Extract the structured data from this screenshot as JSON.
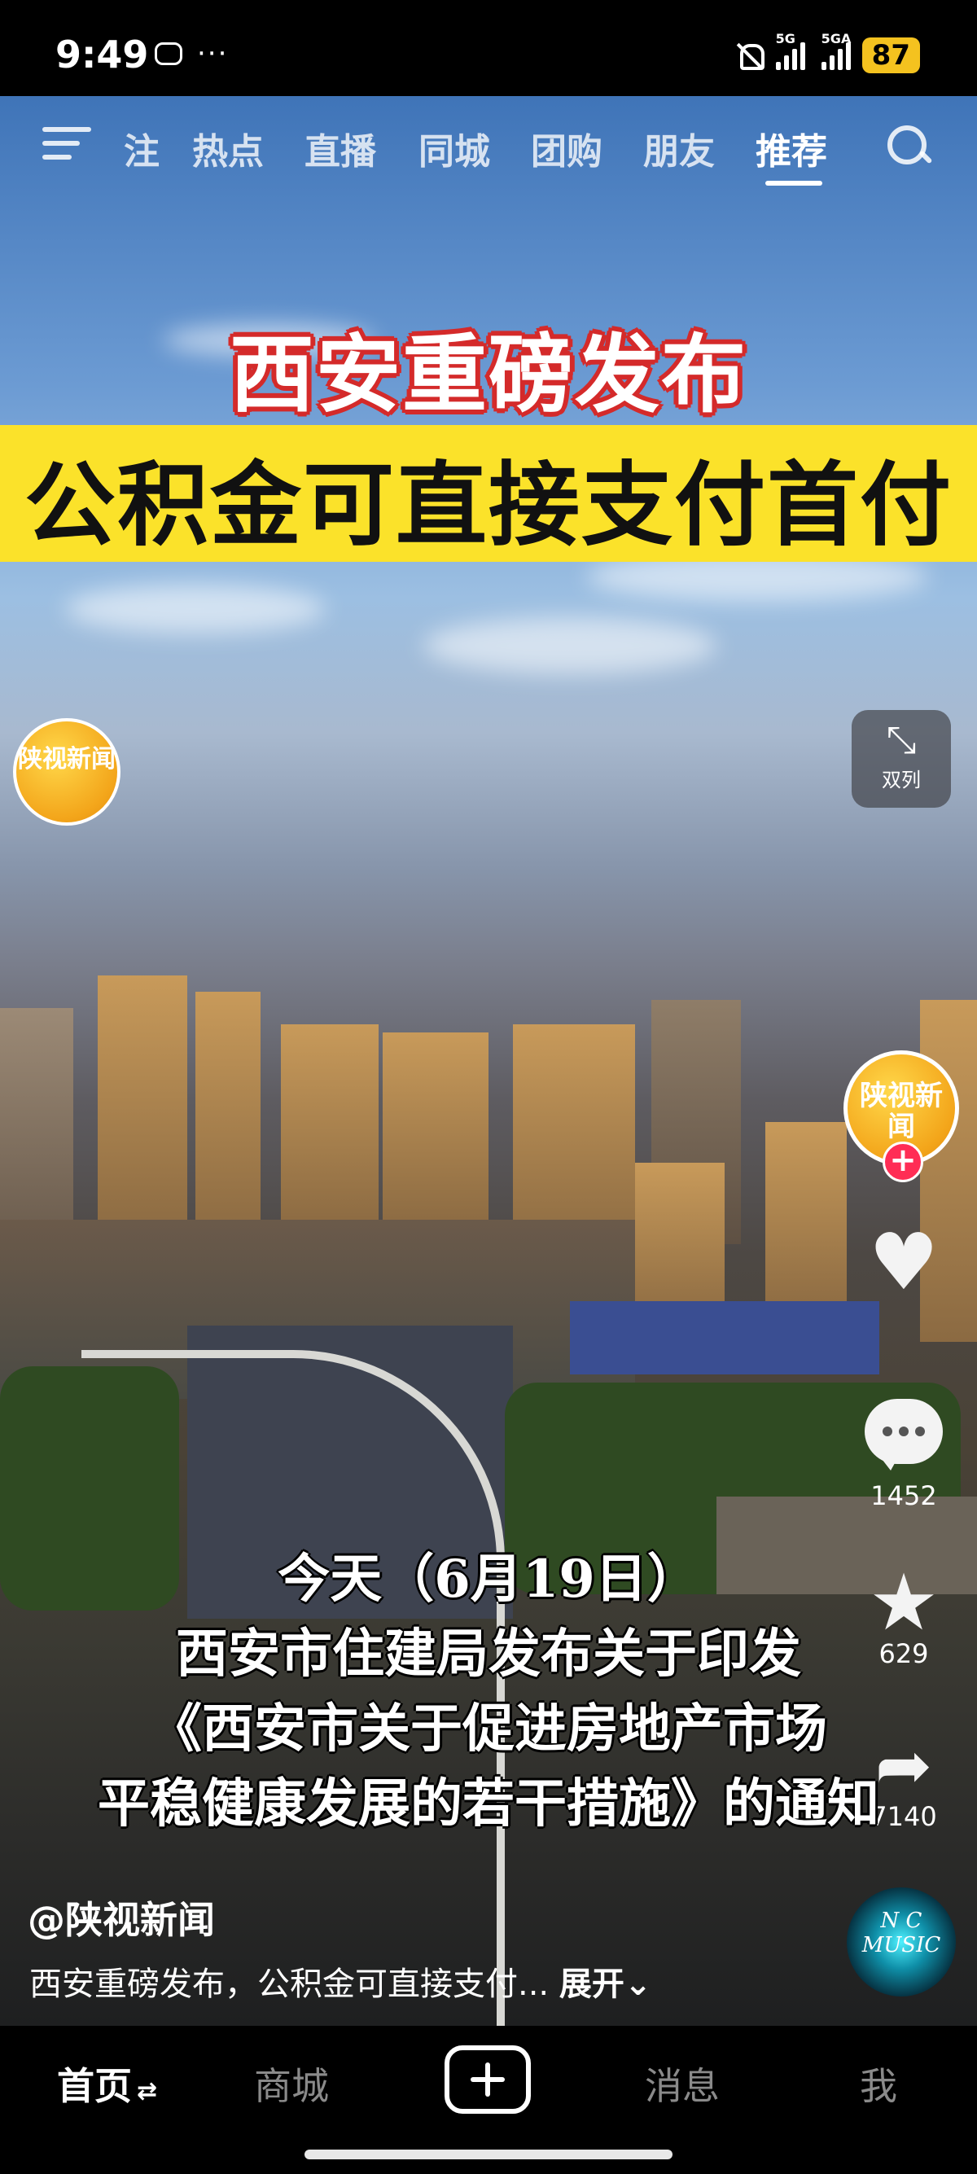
{
  "status_bar": {
    "time": "9:49",
    "more": "···",
    "signal1_label": "5G",
    "signal2_label": "5GA",
    "battery": "87"
  },
  "top_tabs": [
    {
      "label": "注",
      "active": false
    },
    {
      "label": "热点",
      "active": false
    },
    {
      "label": "直播",
      "active": false
    },
    {
      "label": "同城",
      "active": false
    },
    {
      "label": "团购",
      "active": false
    },
    {
      "label": "朋友",
      "active": false
    },
    {
      "label": "推荐",
      "active": true
    }
  ],
  "video": {
    "headline_line1": "西安重磅发布",
    "headline_line2": "公积金可直接支付首付",
    "source_logo": "陕视新闻",
    "dual_column_label": "双列",
    "subtitles": [
      "今天（6月19日）",
      "西安市住建局发布关于印发",
      "《西安市关于促进房地产市场",
      "平稳健康发展的若干措施》的通知"
    ]
  },
  "rail": {
    "avatar_text": "陕视新闻",
    "follow": "+",
    "like_count": "",
    "comment_count": "1452",
    "favorite_count": "629",
    "share_count": "7140",
    "music_text": "N C MUSIC"
  },
  "post": {
    "author": "@陕视新闻",
    "caption": "西安重磅发布，公积金可直接支付...",
    "expand": "展开"
  },
  "bottom_nav": {
    "home": "首页",
    "mall": "商城",
    "messages": "消息",
    "me": "我"
  },
  "colors": {
    "headline_band": "#fbe22a",
    "headline_outline": "#d42a2a",
    "battery": "#f4c21f",
    "follow": "#ff2d55"
  }
}
